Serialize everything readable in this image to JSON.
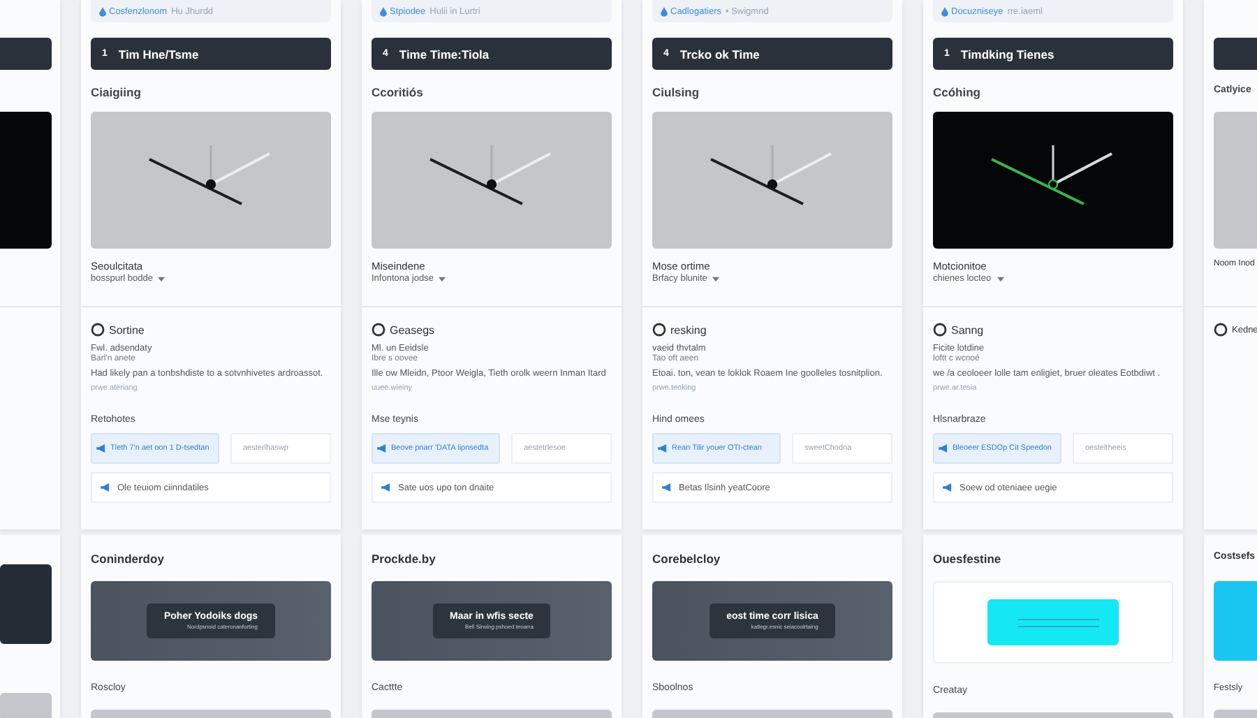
{
  "columns": [
    {
      "kind": "partial"
    },
    {
      "kind": "full",
      "link": "Cosfenzlonom",
      "link_note": "Hu Jhurdd",
      "number": "1",
      "title": "Tim Hne/Tsme",
      "section": "Ciaigiing",
      "caption": "Seoulcitata",
      "dropdown": "bosspurl bodde",
      "option": "Sortine",
      "line_1": "Fwl. adsendaty",
      "line_2": "Barl'n anete",
      "paragraph": "Had likely pan a tonbshdiste to a sotvnhivetes ardroassot.",
      "more": "prwe.ateriang",
      "actions_label": "Retohotes",
      "primary": "Tleth 7'n aet oon 1 D-tsedtan",
      "secondary": "aesterlhaswp",
      "footer_link": "Ole teuiom ciinndatiles",
      "card_title": "Coninderdoy",
      "overlay_title": "Poher Yodoiks dogs",
      "overlay_sub": "Nordpsnoid cateronanforting",
      "card_label": "Roscloy"
    },
    {
      "kind": "full",
      "link": "Stpiodee",
      "link_note": "Hulii in Lurtri",
      "number": "4",
      "title": "Time Time:Tiola",
      "section": "Ccoritiós",
      "caption": "Miseindene",
      "dropdown": "Infontona jodse",
      "option": "Geasegs",
      "line_1": "Ml. un Eeidsle",
      "line_2": "Ibre s oovee",
      "paragraph": "Ille ow Mleidn, Ptoor Weigla, Tieth orolk weern Inman Itard",
      "more": "uuee.wieiny",
      "actions_label": "Mse teynis",
      "primary": "Beove pnarr 'DATA lipnsedta",
      "secondary": "aestetrlesoe",
      "footer_link": "Sate uos upo ton dnaite",
      "card_title": "Prockde.by",
      "overlay_title": "Maar in wfis secte",
      "overlay_sub": "Bell Sirwing pshoed teoarra",
      "card_label": "Cacttte"
    },
    {
      "kind": "full",
      "link": "Cadlogatiers",
      "link_note": "• Swigmnd",
      "number": "4",
      "title": "Trcko ok Time",
      "section": "Ciulsing",
      "caption": "Mose ortime",
      "dropdown": "Brfacy blunite",
      "option": "resking",
      "line_1": "vaeid thvtalm",
      "line_2": "Tao oft aeen",
      "paragraph": "Etoai. ton, vean te loklok Roaem Ine goolleles tosnitplion.",
      "more": "prwe.teoking",
      "actions_label": "Hind omees",
      "primary": "Rean Tilir youer OTI-ctean",
      "secondary": "sweetChodna",
      "footer_link": "Betas Ilsinh yeatCoore",
      "card_title": "Corebelcloy",
      "overlay_title": "eost time corr lisica",
      "overlay_sub": "katlegr.esnic seiacoolrtaing",
      "card_label": "Sboolnos"
    },
    {
      "kind": "full",
      "link": "Docuzniseye",
      "link_note": "rre.iaeml",
      "number": "1",
      "title": "Timdking Tienes",
      "section": "Ccóhing",
      "caption": "Motcionitoe",
      "dropdown": "chienes locteo",
      "option": "Sanng",
      "line_1": "Ficite lotdine",
      "line_2": "loftt c wcnoé",
      "paragraph": "we /a ceoloeer lolle tam enligiet, bruer oleates Eotbdiwt .",
      "more": "prwe.ar.tesia",
      "actions_label": "Hlsnarbraze",
      "primary": "Bleoeer ESDOp Cit Speedon",
      "secondary": "oesteltheeis",
      "footer_link": "Soew od oteniaee uegie",
      "card_title": "Ouesfestine",
      "card_label": "Creatay"
    },
    {
      "kind": "partial",
      "section": "Catlyice",
      "caption": "Noom Inod",
      "option": "Kedne",
      "card_title": "Costsefs",
      "card_label": "Festsly"
    }
  ]
}
